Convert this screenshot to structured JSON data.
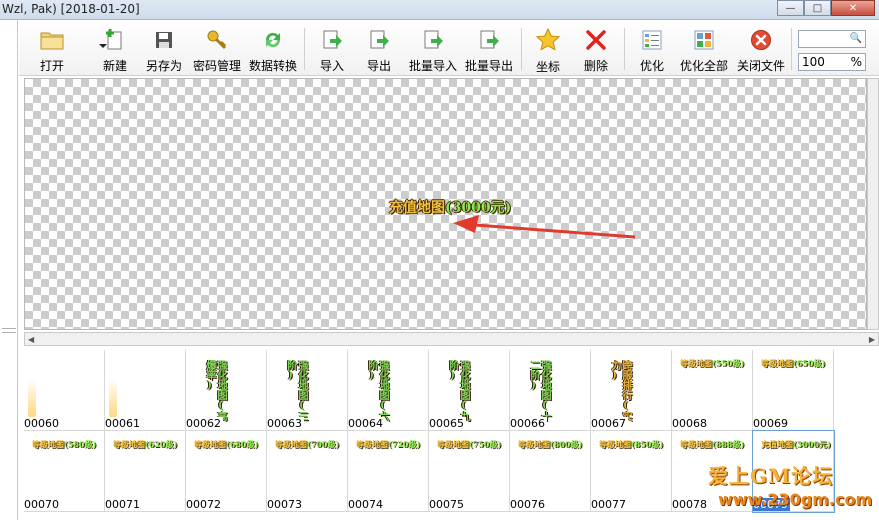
{
  "window": {
    "title": "Wzl, Pak) [2018-01-20]",
    "buttons": {
      "minimize": "—",
      "maximize": "□",
      "close": "✕"
    }
  },
  "toolbar": {
    "open": "打开",
    "new": "新建",
    "save_as": "另存为",
    "password": "密码管理",
    "convert": "数据转换",
    "import": "导入",
    "export": "导出",
    "batch_import": "批量导入",
    "batch_export": "批量导出",
    "coords": "坐标",
    "delete": "删除",
    "optimize": "优化",
    "optimize_all": "优化全部",
    "close_file": "关闭文件",
    "search_value": "",
    "zoom_value": "100",
    "zoom_unit": "%"
  },
  "preview": {
    "label_a": "充值地图",
    "label_b": "(3000元)"
  },
  "thumbnails": [
    {
      "id": "00060",
      "kind": "glow"
    },
    {
      "id": "00061",
      "kind": "glow"
    },
    {
      "id": "00062",
      "kind": "vtext",
      "text": "强化地图(高爆率)"
    },
    {
      "id": "00063",
      "kind": "vtext",
      "text": "强化地图(三阶)"
    },
    {
      "id": "00064",
      "kind": "vtext",
      "text": "强化地图(六阶)"
    },
    {
      "id": "00065",
      "kind": "vtext",
      "text": "强化地图(九阶)"
    },
    {
      "id": "00066",
      "kind": "vtext",
      "text": "强化地图(十二阶)"
    },
    {
      "id": "00067",
      "kind": "vtext_orange",
      "text": "跨服排行(实力)"
    },
    {
      "id": "00068",
      "kind": "htext",
      "text_a": "等级地图",
      "text_b": "(550级)"
    },
    {
      "id": "00069",
      "kind": "htext",
      "text_a": "等级地图",
      "text_b": "(650级)"
    },
    {
      "id": "00070",
      "kind": "htext",
      "text_a": "等级地图",
      "text_b": "(580级)"
    },
    {
      "id": "00071",
      "kind": "htext",
      "text_a": "等级地图",
      "text_b": "(620级)"
    },
    {
      "id": "00072",
      "kind": "htext",
      "text_a": "等级地图",
      "text_b": "(680级)"
    },
    {
      "id": "00073",
      "kind": "htext",
      "text_a": "等级地图",
      "text_b": "(700级)"
    },
    {
      "id": "00074",
      "kind": "htext",
      "text_a": "等级地图",
      "text_b": "(720级)"
    },
    {
      "id": "00075",
      "kind": "htext",
      "text_a": "等级地图",
      "text_b": "(750级)"
    },
    {
      "id": "00076",
      "kind": "htext",
      "text_a": "等级地图",
      "text_b": "(800级)"
    },
    {
      "id": "00077",
      "kind": "htext",
      "text_a": "等级地图",
      "text_b": "(850级)"
    },
    {
      "id": "00078",
      "kind": "htext",
      "text_a": "等级地图",
      "text_b": "(888级)"
    },
    {
      "id": "00079",
      "kind": "htext_sel",
      "text_a": "充值地图",
      "text_b": "(3000元)"
    }
  ],
  "watermark": {
    "line1": "爱上GM论坛",
    "line2": "www.230gm.com"
  },
  "colors": {
    "accent_green": "#8bea4c",
    "accent_gold": "#f3c23d",
    "selection": "#3a78d4"
  }
}
